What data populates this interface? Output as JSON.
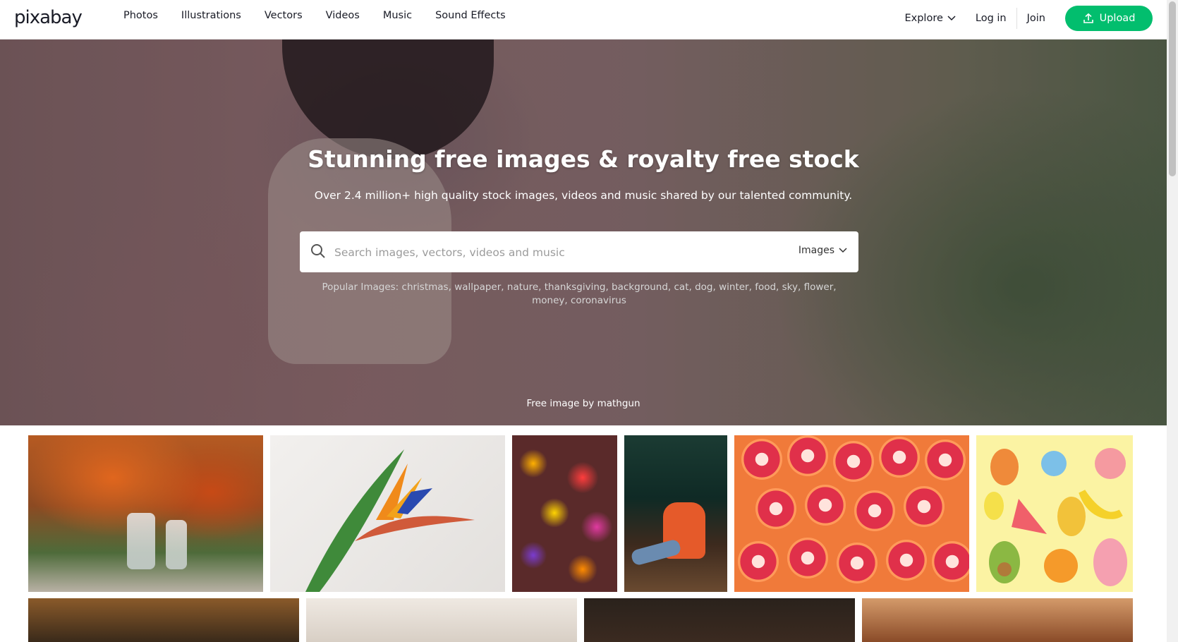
{
  "header": {
    "logo": "pixabay",
    "nav": [
      "Photos",
      "Illustrations",
      "Vectors",
      "Videos",
      "Music",
      "Sound Effects"
    ],
    "explore_label": "Explore",
    "login_label": "Log in",
    "join_label": "Join",
    "upload_label": "Upload"
  },
  "hero": {
    "title": "Stunning free images & royalty free stock",
    "subtitle": "Over 2.4 million+ high quality stock images, videos and music shared by our talented community.",
    "search_placeholder": "Search images, vectors, videos and music",
    "search_type": "Images",
    "popular_label": "Popular Images:",
    "popular_tags": [
      "christmas",
      "wallpaper",
      "nature",
      "thanksgiving",
      "background",
      "cat",
      "dog",
      "winter",
      "food",
      "sky",
      "flower",
      "money",
      "coronavirus"
    ],
    "credit": "Free image by mathgun"
  },
  "colors": {
    "accent": "#02be6e",
    "text": "#191b26"
  }
}
